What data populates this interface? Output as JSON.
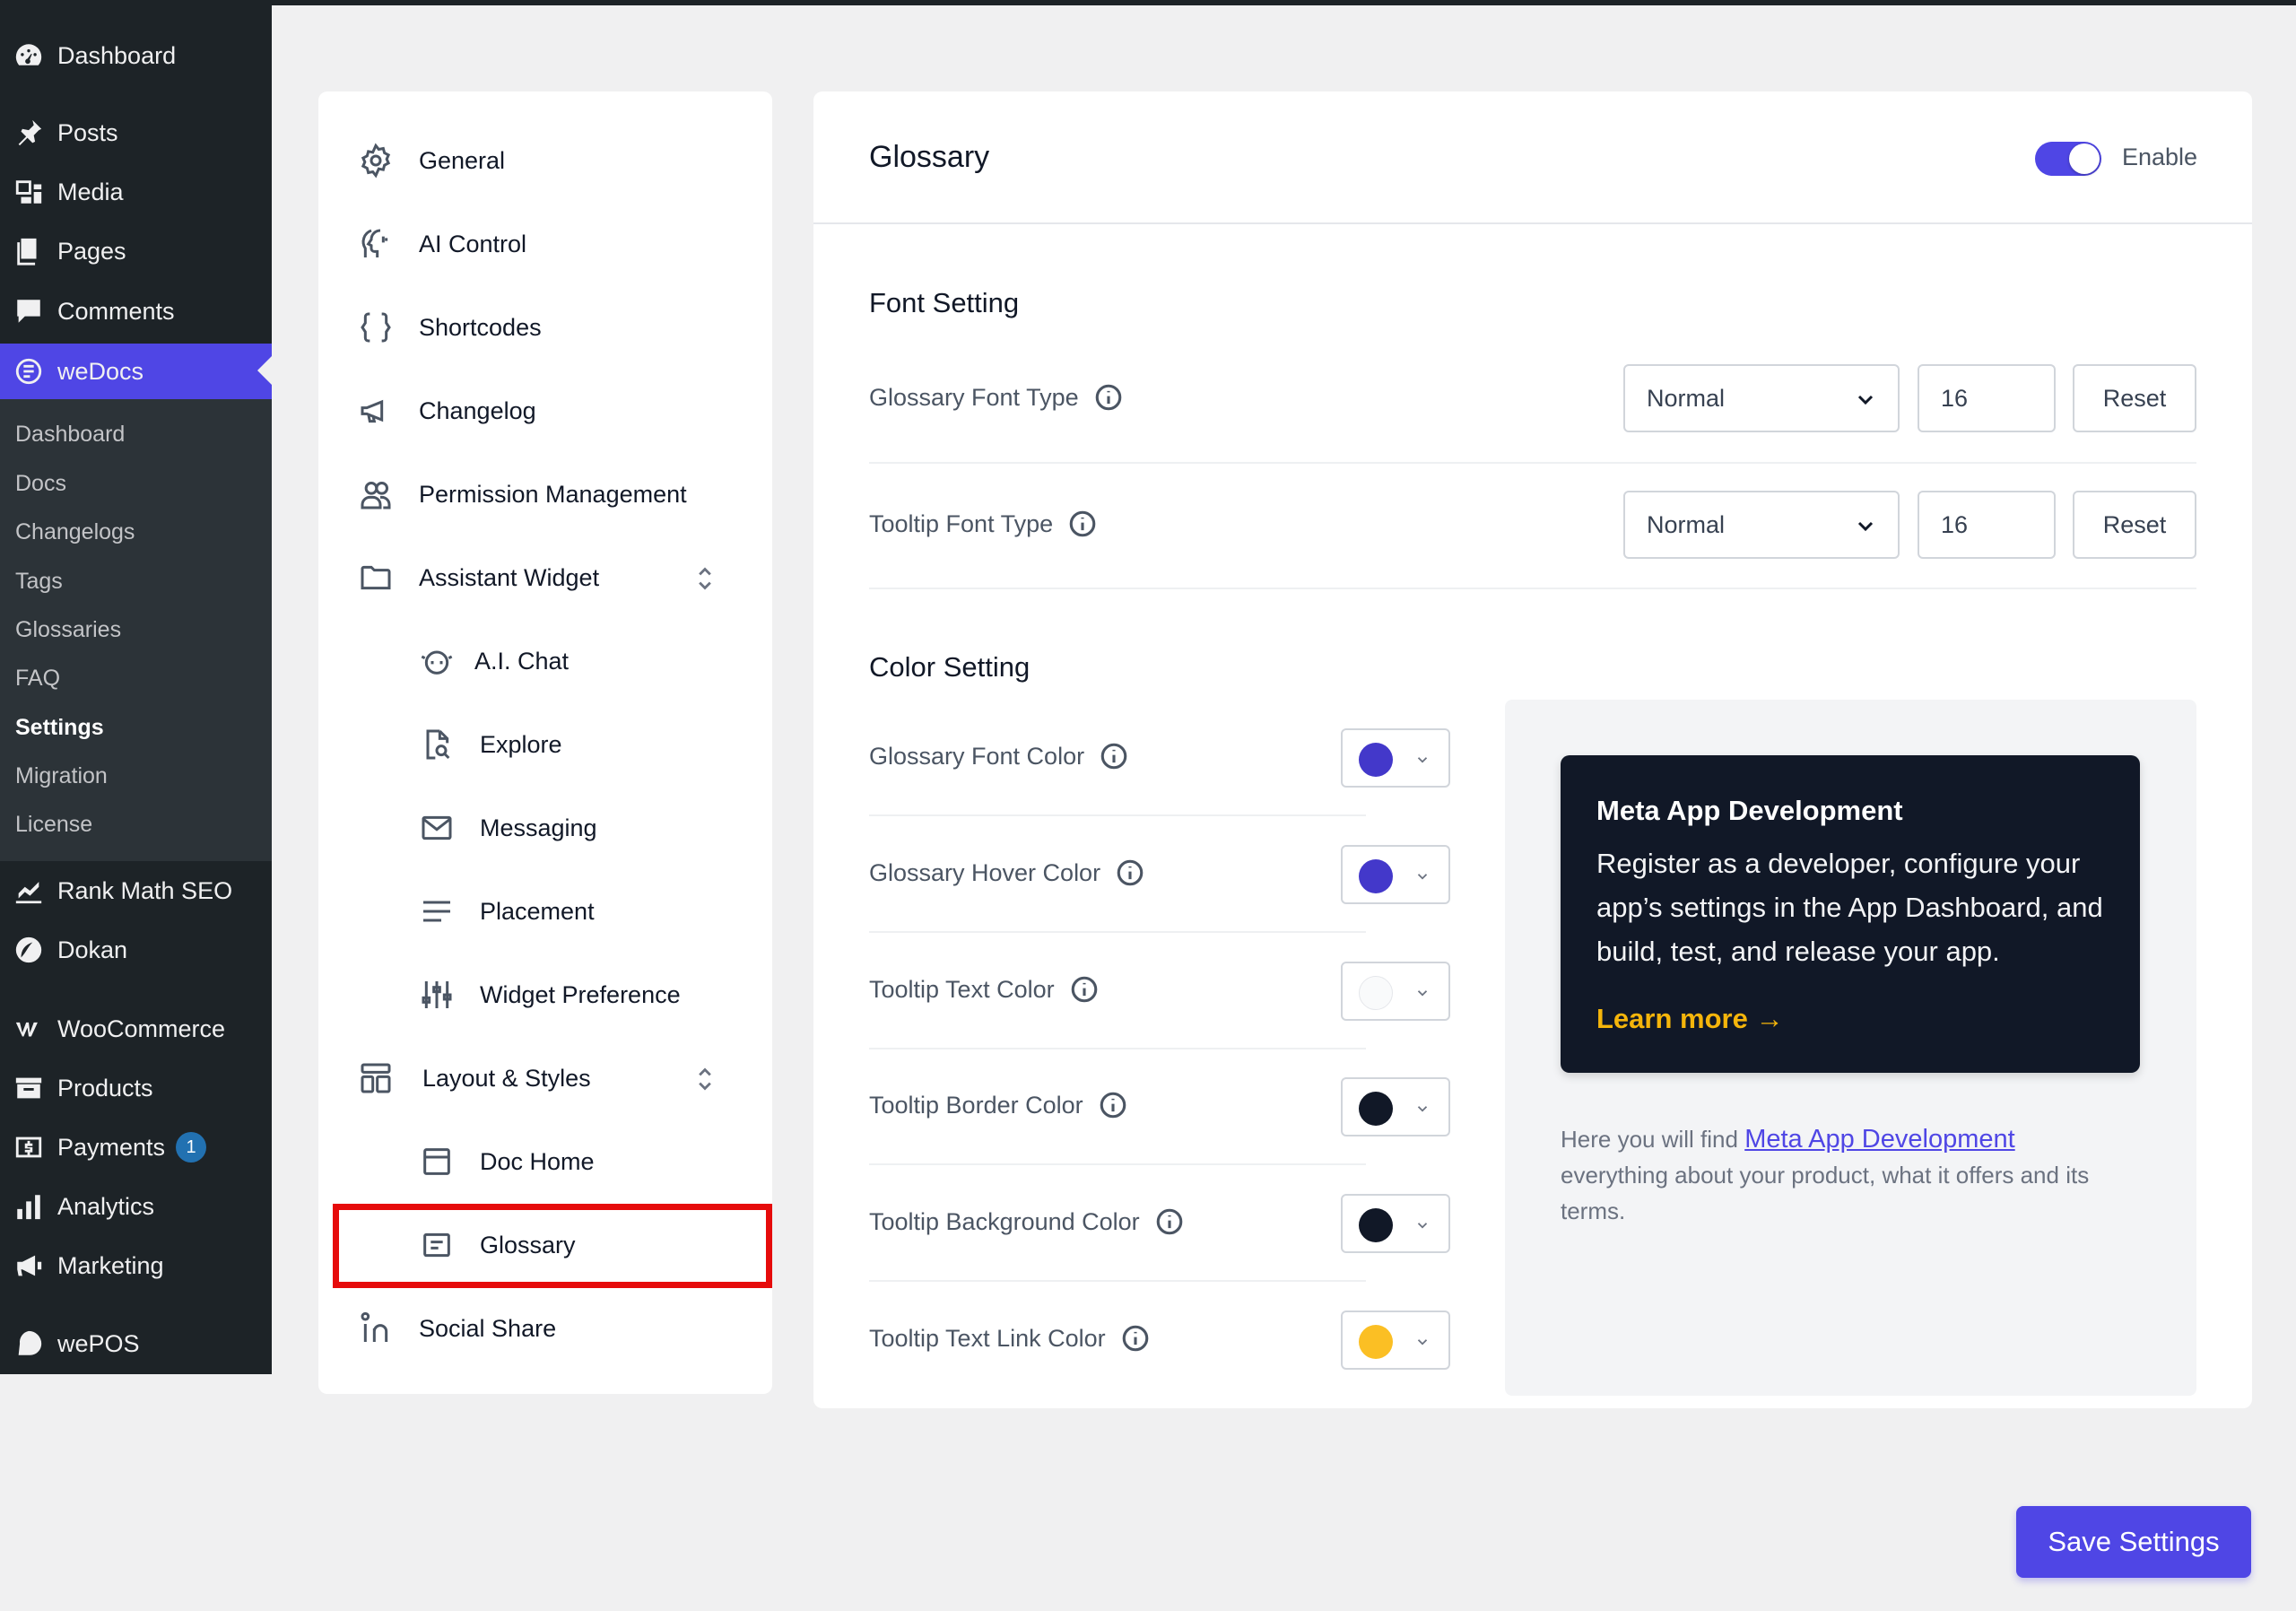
{
  "wp_menu": {
    "items": [
      {
        "label": "Dashboard",
        "icon": "dashboard-icon"
      },
      {
        "label": "Posts",
        "icon": "pin-icon"
      },
      {
        "label": "Media",
        "icon": "media-icon"
      },
      {
        "label": "Pages",
        "icon": "pages-icon"
      },
      {
        "label": "Comments",
        "icon": "comments-icon"
      },
      {
        "label": "weDocs",
        "icon": "wedocs-icon"
      },
      {
        "label": "Rank Math SEO",
        "icon": "rankmath-icon"
      },
      {
        "label": "Dokan",
        "icon": "dokan-icon"
      },
      {
        "label": "WooCommerce",
        "icon": "woocommerce-icon"
      },
      {
        "label": "Products",
        "icon": "products-icon"
      },
      {
        "label": "Payments",
        "icon": "payments-icon",
        "badge": "1"
      },
      {
        "label": "Analytics",
        "icon": "analytics-icon"
      },
      {
        "label": "Marketing",
        "icon": "megaphone-icon"
      },
      {
        "label": "wePOS",
        "icon": "wepos-icon"
      }
    ],
    "submenu": [
      "Dashboard",
      "Docs",
      "Changelogs",
      "Tags",
      "Glossaries",
      "FAQ",
      "Settings",
      "Migration",
      "License"
    ],
    "active_item": "weDocs",
    "current_sub": "Settings"
  },
  "settings_nav": {
    "items": [
      {
        "label": "General",
        "icon": "gear-icon"
      },
      {
        "label": "AI Control",
        "icon": "ai-head-icon"
      },
      {
        "label": "Shortcodes",
        "icon": "braces-icon"
      },
      {
        "label": "Changelog",
        "icon": "megaphone-icon"
      },
      {
        "label": "Permission Management",
        "icon": "users-icon"
      },
      {
        "label": "Assistant Widget",
        "icon": "folder-icon"
      },
      {
        "label": "A.I. Chat",
        "icon": "bot-icon"
      },
      {
        "label": "Explore",
        "icon": "document-search-icon"
      },
      {
        "label": "Messaging",
        "icon": "envelope-icon"
      },
      {
        "label": "Placement",
        "icon": "lines-icon"
      },
      {
        "label": "Widget Preference",
        "icon": "sliders-icon"
      },
      {
        "label": "Layout & Styles",
        "icon": "layout-icon"
      },
      {
        "label": "Doc Home",
        "icon": "window-icon"
      },
      {
        "label": "Glossary",
        "icon": "list-box-icon"
      },
      {
        "label": "Social Share",
        "icon": "linkedin-icon"
      }
    ],
    "selected": "Glossary"
  },
  "main": {
    "title": "Glossary",
    "enable_label": "Enable",
    "enabled": true,
    "font_section_title": "Font Setting",
    "font_rows": [
      {
        "label": "Glossary Font Type",
        "select_value": "Normal",
        "size_value": "16",
        "reset_label": "Reset"
      },
      {
        "label": "Tooltip Font Type",
        "select_value": "Normal",
        "size_value": "16",
        "reset_label": "Reset"
      }
    ],
    "color_section_title": "Color Setting",
    "color_rows": [
      {
        "label": "Glossary Font Color",
        "color": "#4338ca"
      },
      {
        "label": "Glossary Hover Color",
        "color": "#4338ca"
      },
      {
        "label": "Tooltip Text Color",
        "color": "#f9fafb"
      },
      {
        "label": "Tooltip Border Color",
        "color": "#111827"
      },
      {
        "label": "Tooltip Background Color",
        "color": "#111827"
      },
      {
        "label": "Tooltip Text Link Color",
        "color": "#fbbf24"
      }
    ]
  },
  "info_panel": {
    "card_title": "Meta App Development",
    "card_description": "Register as a developer, configure your app’s settings in the App Dashboard, and build, test, and release your app.",
    "learn_more": "Learn more →",
    "text_before_link": "Here you will find",
    "link_text": "Meta App Development",
    "text_after_link": "everything about your product, what it offers and its terms."
  },
  "save_button_label": "Save Settings",
  "accent_color": "#4f46e5"
}
